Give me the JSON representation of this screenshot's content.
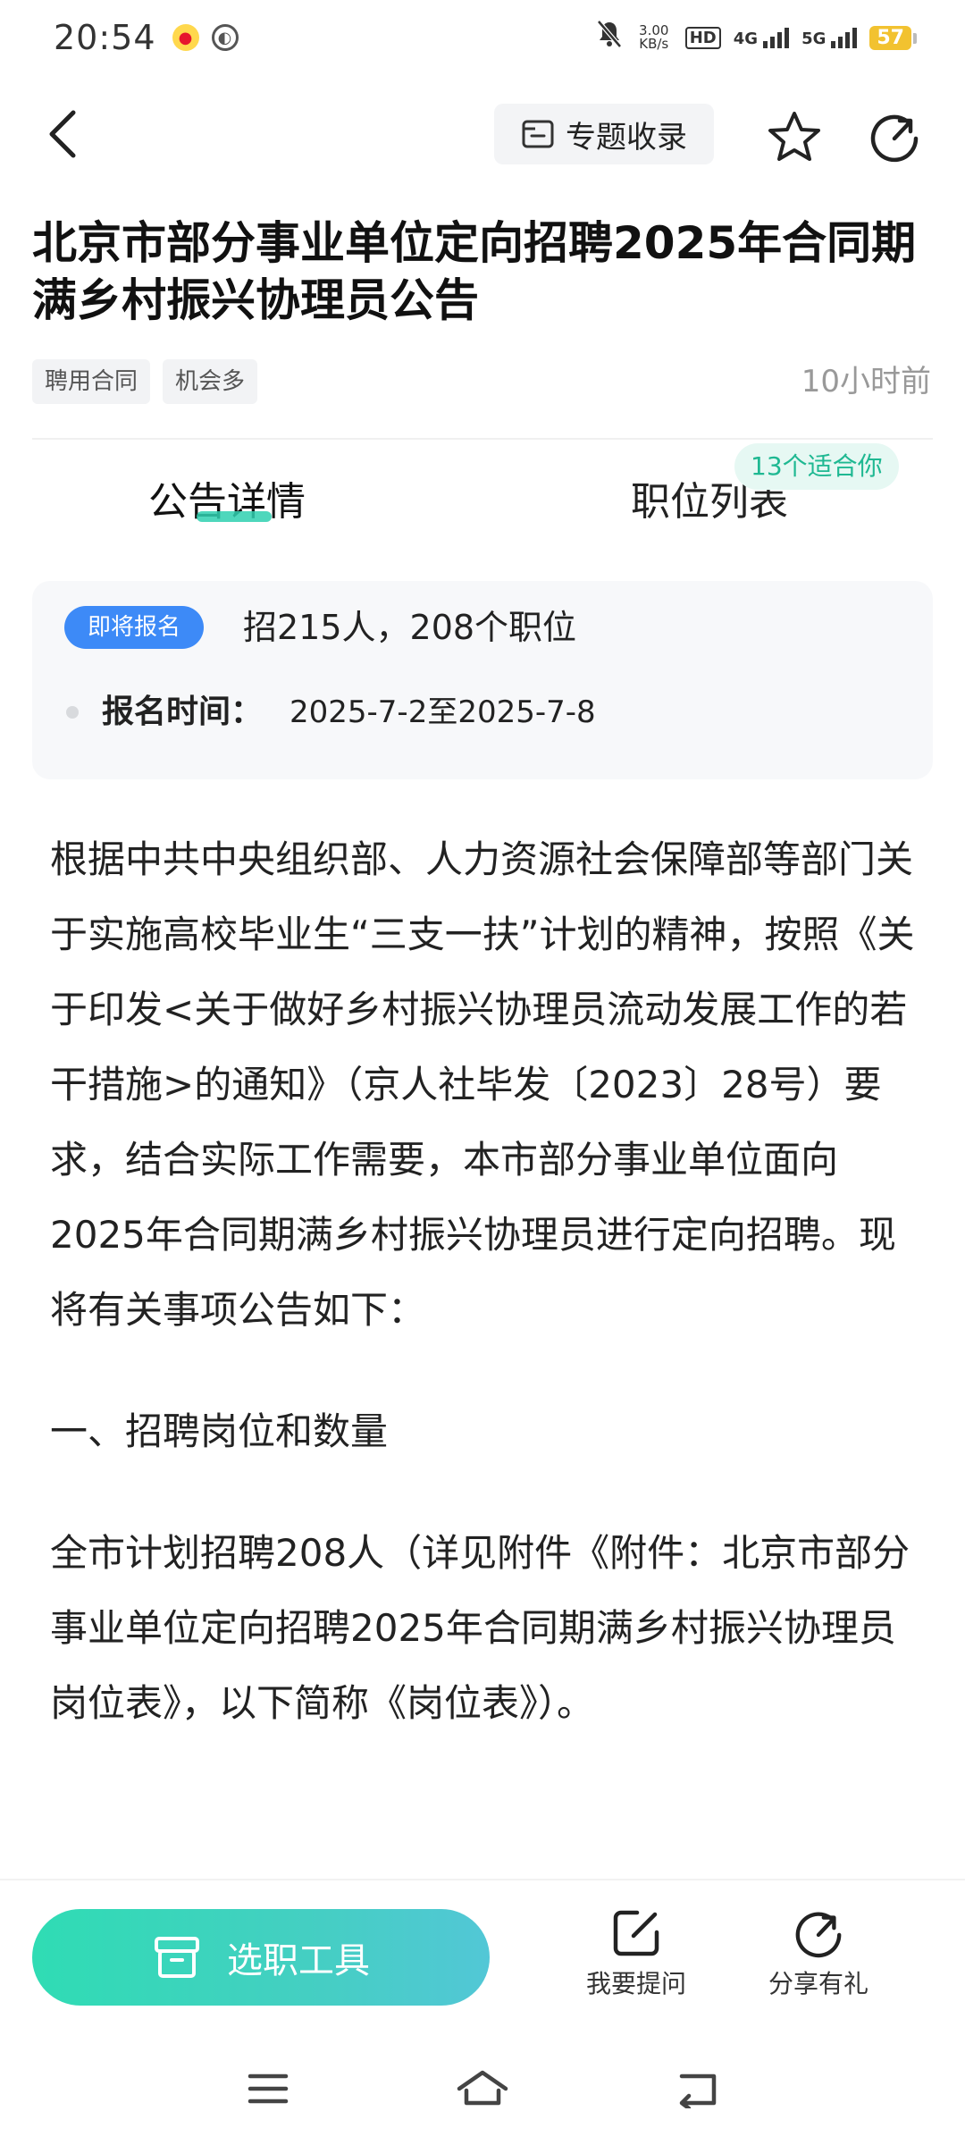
{
  "status_bar": {
    "time": "20:54",
    "speed_value": "3.00",
    "speed_unit": "KB/s",
    "hd_label": "HD",
    "net_4g": "4G",
    "net_5g": "5G",
    "battery": "57"
  },
  "nav": {
    "collect_label": "专题收录"
  },
  "article_header": {
    "title": "北京市部分事业单位定向招聘2025年合同期满乡村振兴协理员公告",
    "tags": [
      "聘用合同",
      "机会多"
    ],
    "time_ago": "10小时前"
  },
  "tabs": {
    "details": "公告详情",
    "positions": "职位列表",
    "fit_badge": "13个适合你"
  },
  "info_card": {
    "status": "即将报名",
    "summary": "招215人，208个职位",
    "reg_label": "报名时间：",
    "reg_value": "2025-7-2至2025-7-8"
  },
  "body": {
    "paragraph1": "根据中共中央组织部、人力资源社会保障部等部门关于实施高校毕业生“三支一扶”计划的精神，按照《关于印发<关于做好乡村振兴协理员流动发展工作的若干措施>的通知》（京人社毕发〔2023〕28号）要求，结合实际工作需要，本市部分事业单位面向2025年合同期满乡村振兴协理员进行定向招聘。现将有关事项公告如下：",
    "heading1": "一、招聘岗位和数量",
    "paragraph2": "全市计划招聘208人（详见附件《附件：北京市部分事业单位定向招聘2025年合同期满乡村振兴协理员岗位表》，以下简称《岗位表》）。"
  },
  "bottom_bar": {
    "tool_label": "选职工具",
    "ask_label": "我要提问",
    "share_label": "分享有礼"
  },
  "colors": {
    "accent": "#2fd0b0",
    "status_pill": "#3d8af7",
    "badge_text": "#1fb892"
  },
  "icons": {
    "back": "chevron-left-icon",
    "collect": "folder-icon",
    "favorite": "star-icon",
    "share": "share-arrow-icon",
    "tool": "box-icon",
    "ask": "edit-icon",
    "menu": "menu-icon",
    "home": "home-icon",
    "sys_back": "back-icon"
  }
}
